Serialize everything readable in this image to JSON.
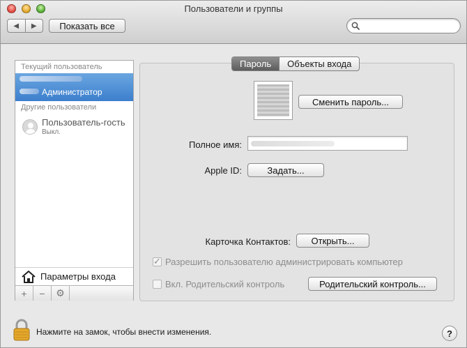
{
  "window": {
    "title": "Пользователи и группы"
  },
  "toolbar": {
    "back_glyph": "◀",
    "forward_glyph": "▶",
    "show_all_label": "Показать все",
    "search_value": "",
    "search_placeholder": ""
  },
  "sidebar": {
    "current_section": "Текущий пользователь",
    "admin_role": "Администратор",
    "other_section": "Другие пользователи",
    "guest_name": "Пользователь-гость",
    "guest_status": "Выкл.",
    "login_options_label": "Параметры входа",
    "add_glyph": "+",
    "remove_glyph": "−",
    "gear_glyph": "⚙"
  },
  "tabs": [
    {
      "label": "Пароль",
      "active": true
    },
    {
      "label": "Объекты входа",
      "active": false
    }
  ],
  "password_pane": {
    "change_password_label": "Сменить пароль...",
    "full_name_label": "Полное имя:",
    "apple_id_label": "Apple ID:",
    "apple_id_button": "Задать...",
    "contacts_card_label": "Карточка Контактов:",
    "open_button": "Открыть...",
    "allow_admin_label": "Разрешить пользователю администрировать компьютер",
    "allow_admin_checked": true,
    "parental_label": "Вкл. Родительский контроль",
    "parental_checked": false,
    "parental_button": "Родительский контроль..."
  },
  "footer": {
    "lock_text": "Нажмите на замок, чтобы внести изменения.",
    "help_glyph": "?"
  },
  "colors": {
    "selection": "#3d7fcd",
    "window_bg": "#e8e8e8"
  }
}
